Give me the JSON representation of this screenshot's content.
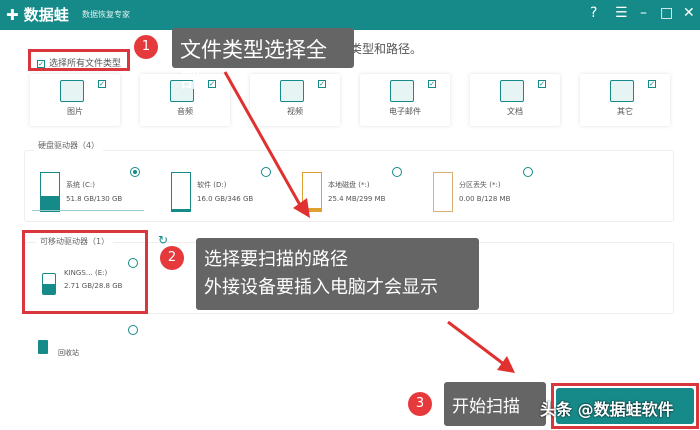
{
  "app": {
    "name": "数据蛙",
    "subtitle": "数据恢复专家",
    "controls": [
      "?",
      "☰",
      "–",
      "□",
      "✕"
    ]
  },
  "heading": "请选择需要恢复的数据类型和路径。",
  "select_all": "选择所有文件类型",
  "file_types": [
    {
      "label": "图片",
      "icon": "image-icon"
    },
    {
      "label": "音频",
      "icon": "audio-icon"
    },
    {
      "label": "视频",
      "icon": "video-icon"
    },
    {
      "label": "电子邮件",
      "icon": "email-icon"
    },
    {
      "label": "文档",
      "icon": "document-icon"
    },
    {
      "label": "其它",
      "icon": "other-icon"
    }
  ],
  "hard_drives": {
    "label": "硬盘驱动器（4）",
    "items": [
      {
        "name": "系统 (C:)",
        "size": "51.8 GB/130 GB",
        "selected": true,
        "fill": 0.4
      },
      {
        "name": "软件 (D:)",
        "size": "16.0 GB/346 GB",
        "selected": false,
        "fill": 0.05
      },
      {
        "name": "本地磁盘 (*:)",
        "size": "25.4 MB/299 MB",
        "selected": false,
        "fill": 0.08
      },
      {
        "name": "分区丢失 (*:)",
        "size": "0.00  B/128 MB",
        "selected": false,
        "fill": 0
      }
    ]
  },
  "removable": {
    "label": "可移动驱动器（1）",
    "items": [
      {
        "name": "KINGS… (E:)",
        "size": "2.71 GB/28.8 GB",
        "selected": false
      }
    ]
  },
  "recycle_bin": "回收站",
  "annotations": [
    {
      "num": "1",
      "text": "文件类型选择全部"
    },
    {
      "num": "2",
      "line1": "选择要扫描的路径",
      "line2": "外接设备要插入电脑才会显示"
    },
    {
      "num": "3",
      "text": "开始扫描"
    }
  ],
  "watermark": "头条 @数据蛙软件",
  "colors": {
    "accent": "#168a89",
    "annotation": "#e5393b"
  }
}
